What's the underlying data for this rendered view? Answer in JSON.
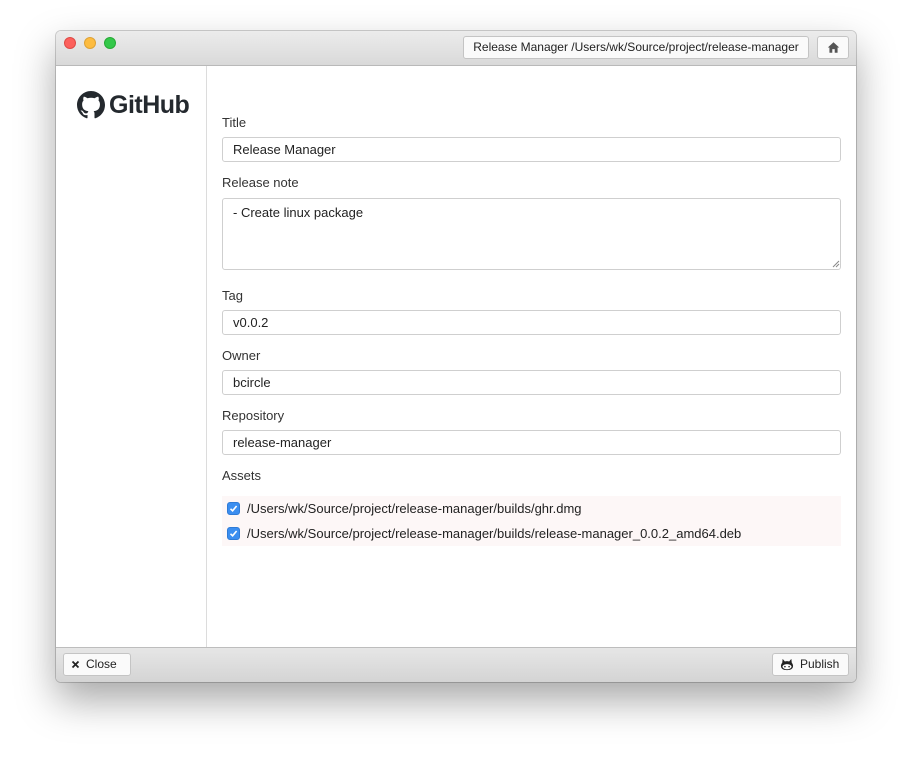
{
  "titlebar": {
    "path_label": "Release Manager /Users/wk/Source/project/release-manager",
    "home_icon": "home-icon"
  },
  "sidebar": {
    "logo_text": "GitHub",
    "logo_icon": "github-octocat-icon"
  },
  "form": {
    "title_label": "Title",
    "title_value": "Release Manager",
    "note_label": "Release note",
    "note_value": "- Create linux package",
    "tag_label": "Tag",
    "tag_value": "v0.0.2",
    "owner_label": "Owner",
    "owner_value": "bcircle",
    "repo_label": "Repository",
    "repo_value": "release-manager",
    "assets_label": "Assets",
    "assets": [
      {
        "path": "/Users/wk/Source/project/release-manager/builds/ghr.dmg",
        "checked": true
      },
      {
        "path": "/Users/wk/Source/project/release-manager/builds/release-manager_0.0.2_amd64.deb",
        "checked": true
      }
    ]
  },
  "footer": {
    "close_label": "Close",
    "publish_label": "Publish"
  },
  "colors": {
    "accent": "#3b8ef0",
    "traffic_close": "#fc605c",
    "traffic_min": "#fdbc40",
    "traffic_max": "#34c84a"
  }
}
